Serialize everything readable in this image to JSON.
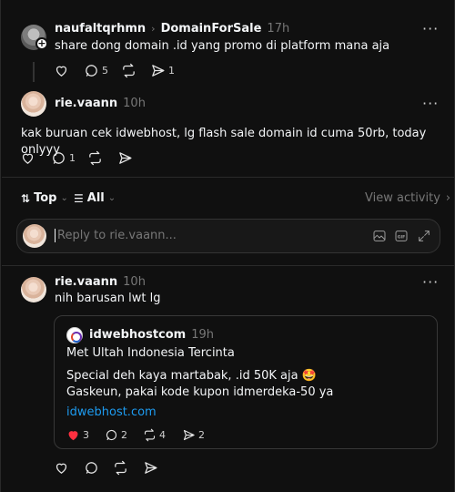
{
  "root_post": {
    "author": "naufaltqrhmn",
    "community": "DomainForSale",
    "time": "17h",
    "text": "share dong domain .id yang promo di platform mana aja",
    "replies_count": "5",
    "shares_count": "1"
  },
  "reply_post": {
    "author": "rie.vaann",
    "time": "10h",
    "text": "kak buruan cek idwebhost, lg flash sale domain id cuma 50rb, today onlyyy",
    "replies_count": "1"
  },
  "sort_bar": {
    "sort_label": "Top",
    "filter_label": "All",
    "view_activity": "View activity"
  },
  "reply_box": {
    "placeholder": "Reply to rie.vaann..."
  },
  "nested_reply": {
    "author": "rie.vaann",
    "time": "10h",
    "text": "nih barusan lwt lg",
    "quote": {
      "author": "idwebhostcom",
      "time": "19h",
      "line1": "Met Ultah Indonesia Tercinta",
      "line2": "Special deh kaya martabak, .id 50K aja 🤩",
      "line3": "Gaskeun, pakai kode kupon idmerdeka-50 ya",
      "link": "idwebhost.com",
      "likes": "3",
      "replies": "2",
      "reposts": "4",
      "shares": "2"
    }
  },
  "colors": {
    "background": "#101010",
    "link": "#1d9bf0",
    "like_active": "#ff3040"
  },
  "icons": [
    "heart-icon",
    "comment-icon",
    "repost-icon",
    "share-icon",
    "more-icon",
    "image-icon",
    "gif-icon",
    "expand-icon",
    "sort-icon",
    "filter-icon",
    "chevron-right-icon"
  ]
}
